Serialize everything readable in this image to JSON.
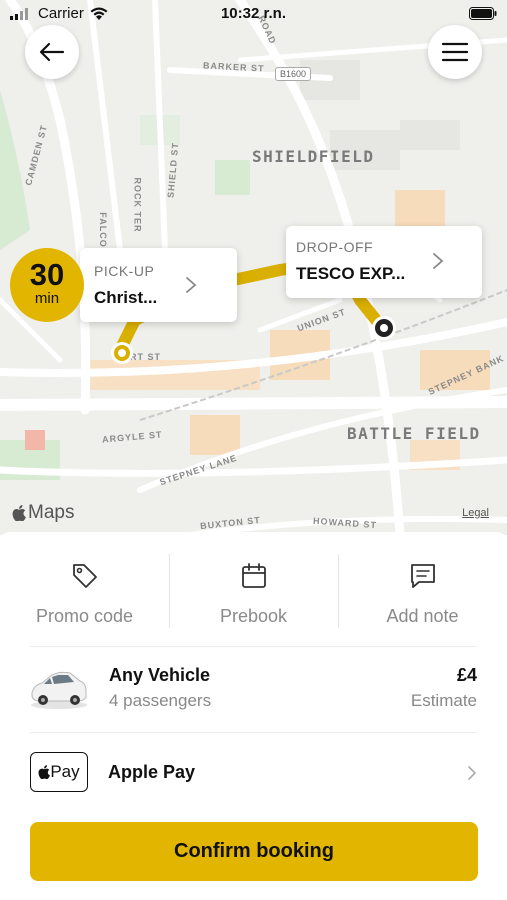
{
  "status_bar": {
    "carrier": "Carrier",
    "time": "10:32 r.n."
  },
  "map": {
    "districts": [
      "SHIELDFIELD",
      "BATTLE FIELD"
    ],
    "streets": {
      "barker": "BARKER ST",
      "camden": "CAMDEN ST",
      "rock_ter": "ROCK TER",
      "shield": "SHIELD ST",
      "falcon": "FALCO",
      "union": "UNION ST",
      "stepney_bank": "STEPNEY BANK",
      "argyle": "ARGYLE ST",
      "stepney_lane": "STEPNEY LANE",
      "buxton": "BUXTON ST",
      "howard": "HOWARD ST",
      "road": "ROAD",
      "rt": "RT ST"
    },
    "road_shield": "B1600",
    "attribution": "Maps",
    "legal": "Legal"
  },
  "eta": {
    "value": "30",
    "unit": "min"
  },
  "pickup": {
    "label": "PICK-UP",
    "place": "Christ..."
  },
  "dropoff": {
    "label": "DROP-OFF",
    "place": "TESCO EXP..."
  },
  "actions": [
    {
      "label": "Promo code",
      "icon": "tag-icon"
    },
    {
      "label": "Prebook",
      "icon": "calendar-icon"
    },
    {
      "label": "Add note",
      "icon": "note-icon"
    }
  ],
  "vehicle": {
    "name": "Any Vehicle",
    "passengers": "4 passengers",
    "price": "£4",
    "price_note": "Estimate"
  },
  "payment": {
    "badge": "Pay",
    "label": "Apple Pay"
  },
  "confirm_label": "Confirm booking",
  "colors": {
    "accent": "#e2b600",
    "route": "#d9af00"
  }
}
